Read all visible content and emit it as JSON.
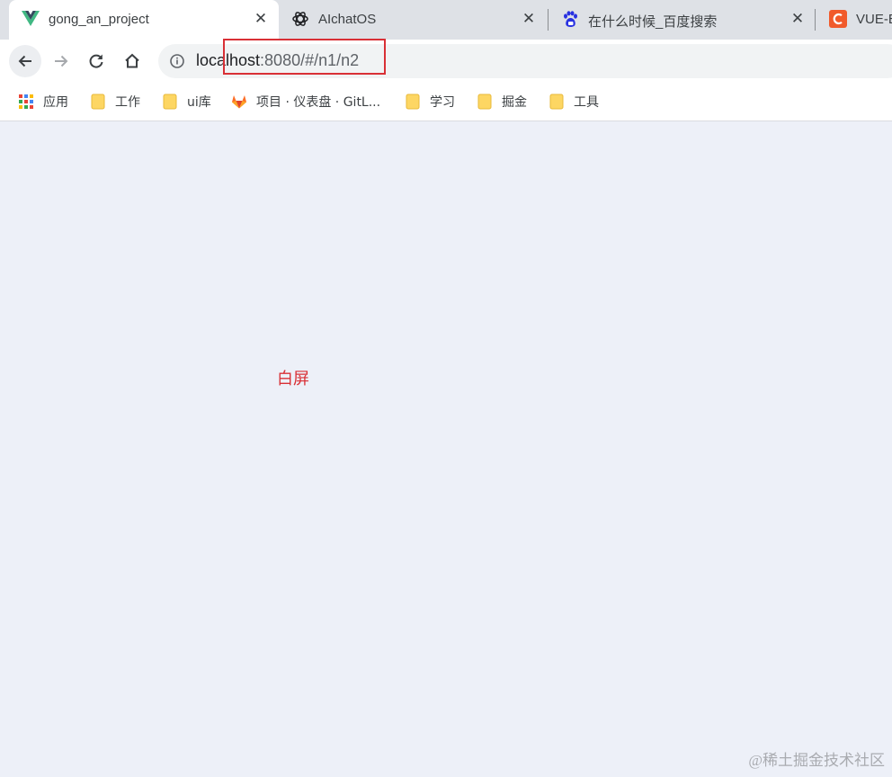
{
  "tabs": [
    {
      "title": "gong_an_project",
      "icon": "vue-logo-icon",
      "active": true,
      "close": "✕"
    },
    {
      "title": "AIchatOS",
      "icon": "openai-logo-icon",
      "active": false,
      "close": "✕"
    },
    {
      "title": "在什么时候_百度搜索",
      "icon": "baidu-paw-icon",
      "active": false,
      "close": "✕"
    },
    {
      "title": "VUE-E",
      "icon": "c-logo-icon",
      "active": false
    }
  ],
  "toolbar": {
    "url_host": "localhost",
    "url_rest": ":8080/#/n1/n2"
  },
  "bookmarks": [
    {
      "label": "应用",
      "icon": "apps-grid-icon"
    },
    {
      "label": "工作",
      "icon": "folder-icon"
    },
    {
      "label": "ui库",
      "icon": "folder-icon"
    },
    {
      "label": "项目 · 仪表盘 · GitL...",
      "icon": "gitlab-icon"
    },
    {
      "label": "学习",
      "icon": "folder-icon"
    },
    {
      "label": "掘金",
      "icon": "folder-icon"
    },
    {
      "label": "工具",
      "icon": "folder-icon"
    }
  ],
  "content": {
    "annotation": "白屏",
    "watermark": "@稀土掘金技术社区"
  },
  "colors": {
    "highlight": "#d93036",
    "page_background": "#edf0f8",
    "vue_green": "#41b883",
    "vue_dark": "#35495e",
    "baidu_blue": "#2932e1",
    "c_orange": "#f15a2b",
    "gitlab_orange": "#e24329",
    "folder_yellow": "#fdd663"
  }
}
